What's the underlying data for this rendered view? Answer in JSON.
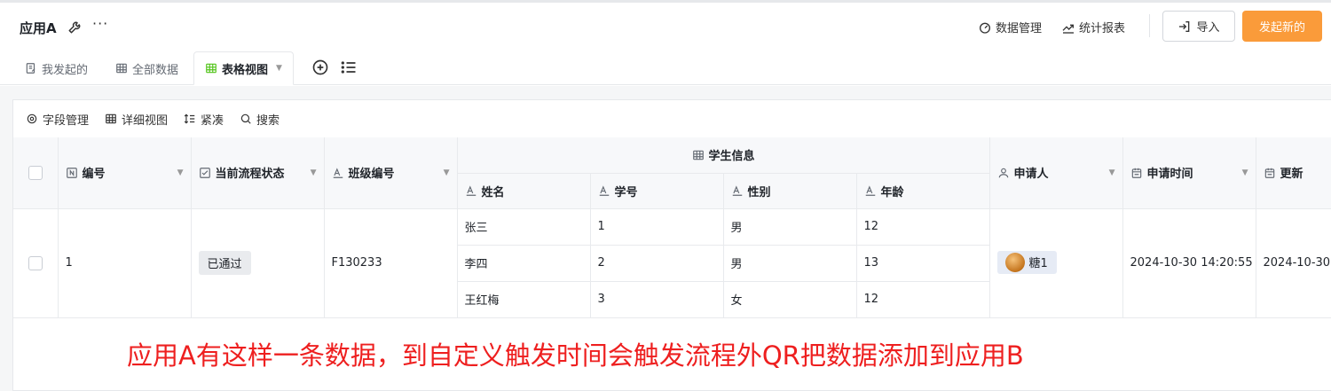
{
  "app": {
    "title": "应用A",
    "more": "···"
  },
  "header": {
    "data_manage": "数据管理",
    "stats_report": "统计报表",
    "import": "导入",
    "primary_action": "发起新的",
    "accent_color": "#fa9b3a"
  },
  "tabs": [
    {
      "label": "我发起的"
    },
    {
      "label": "全部数据"
    },
    {
      "label": "表格视图"
    }
  ],
  "toolbar": {
    "field_manage": "字段管理",
    "detail_view": "详细视图",
    "compact": "紧凑",
    "search": "搜索"
  },
  "table": {
    "columns": {
      "id": "编号",
      "flow_status": "当前流程状态",
      "class_no": "班级编号",
      "group": "学生信息",
      "name": "姓名",
      "student_no": "学号",
      "gender": "性别",
      "age": "年龄",
      "applicant": "申请人",
      "apply_time": "申请时间",
      "update_time": "更新"
    },
    "row": {
      "id": "1",
      "status": "已通过",
      "class_no": "F130233",
      "students": [
        {
          "name": "张三",
          "no": "1",
          "gender": "男",
          "age": "12"
        },
        {
          "name": "李四",
          "no": "2",
          "gender": "男",
          "age": "13"
        },
        {
          "name": "王红梅",
          "no": "3",
          "gender": "女",
          "age": "12"
        }
      ],
      "applicant": "糖1",
      "apply_time": "2024-10-30 14:20:55",
      "update_time": "2024-10-30"
    }
  },
  "annotation": "应用A有这样一条数据，到自定义触发时间会触发流程外QR把数据添加到应用B"
}
